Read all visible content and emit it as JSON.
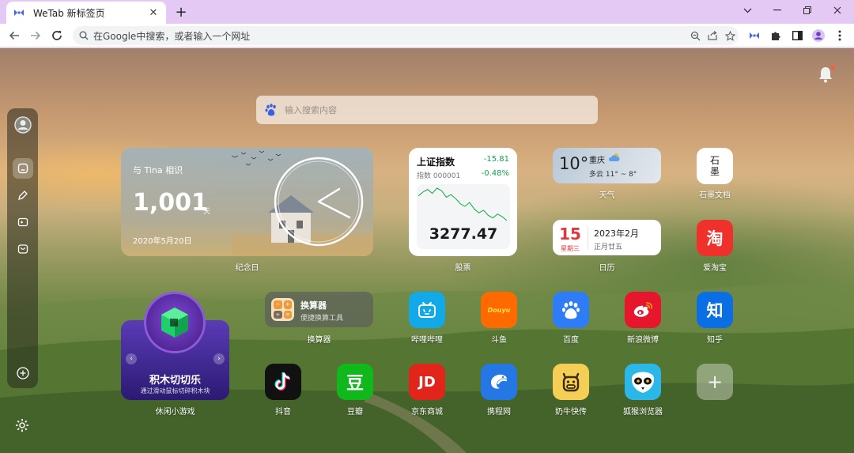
{
  "browser": {
    "tab_title": "WeTab 新标签页",
    "new_tab": "+",
    "tab_close": "✕",
    "omnibox_placeholder": "在Google中搜索，或者输入一个网址"
  },
  "search": {
    "placeholder": "输入搜索内容"
  },
  "widgets": {
    "anniversary": {
      "subtitle": "与 Tina 相识",
      "days": "1,001",
      "unit": "天",
      "date": "2020年5月20日",
      "label": "纪念日"
    },
    "stock": {
      "name": "上证指数",
      "code": "指数 000001",
      "change": "-15.81",
      "percent": "-0.48%",
      "value": "3277.47",
      "label": "股票"
    },
    "weather": {
      "temp": "10°",
      "city": "重庆",
      "desc": "多云 11° ~ 8°",
      "label": "天气"
    },
    "calendar": {
      "day": "15",
      "weekday": "星期三",
      "month": "2023年2月",
      "lunar": "正月廿五",
      "label": "日历"
    },
    "calculator": {
      "title": "换算器",
      "subtitle": "便捷换算工具",
      "label": "换算器"
    },
    "game": {
      "title": "积木切切乐",
      "subtitle": "通过滑动鼠标切碎积木块",
      "label": "休闲小游戏"
    }
  },
  "apps": [
    {
      "name": "石墨文档",
      "icon": "石\n墨"
    },
    {
      "name": "爱淘宝",
      "icon": "淘"
    },
    {
      "name": "哔哩哔哩",
      "icon": ""
    },
    {
      "name": "斗鱼",
      "icon": "Douyu"
    },
    {
      "name": "百度",
      "icon": "du"
    },
    {
      "name": "新浪微博",
      "icon": ""
    },
    {
      "name": "知乎",
      "icon": "知"
    },
    {
      "name": "抖音",
      "icon": "♪"
    },
    {
      "name": "豆瓣",
      "icon": "豆"
    },
    {
      "name": "京东商城",
      "icon": "JD"
    },
    {
      "name": "携程网",
      "icon": ""
    },
    {
      "name": "奶牛快传",
      "icon": ""
    },
    {
      "name": "狐猴浏览器",
      "icon": ""
    },
    {
      "name": "",
      "icon": "+"
    }
  ],
  "stock_chart": {
    "type": "line",
    "values": [
      3296,
      3299,
      3301,
      3298,
      3302,
      3300,
      3295,
      3297,
      3294,
      3290,
      3288,
      3291,
      3286,
      3283,
      3285,
      3281,
      3279,
      3282,
      3280,
      3277
    ]
  },
  "colors": {
    "tab_strip": "#e3c9f3",
    "stock_line": "#22b04f",
    "stock_down": "#18a04a",
    "calendar_red": "#e0373a"
  }
}
